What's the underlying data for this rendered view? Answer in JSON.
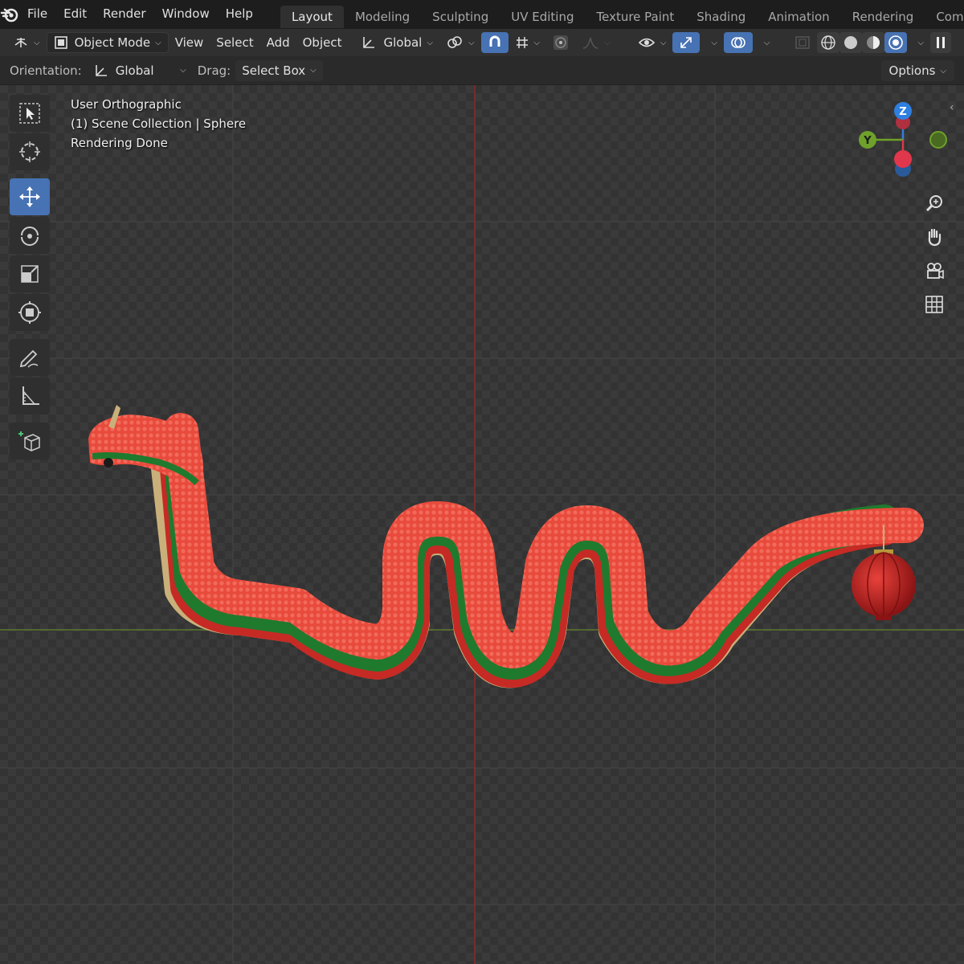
{
  "menubar": {
    "items": [
      "File",
      "Edit",
      "Render",
      "Window",
      "Help"
    ],
    "workspaces": [
      "Layout",
      "Modeling",
      "Sculpting",
      "UV Editing",
      "Texture Paint",
      "Shading",
      "Animation",
      "Rendering",
      "Com"
    ],
    "active_workspace": "Layout"
  },
  "header": {
    "mode": "Object Mode",
    "menus": [
      "View",
      "Select",
      "Add",
      "Object"
    ],
    "transform_orientation": "Global"
  },
  "toolsettings": {
    "orientation_label": "Orientation:",
    "orientation_value": "Global",
    "drag_label": "Drag:",
    "drag_value": "Select Box",
    "options": "Options"
  },
  "viewport": {
    "view_name": "User Orthographic",
    "collection": "(1) Scene Collection | Sphere",
    "status": "Rendering Done"
  },
  "gizmo": {
    "z_label": "Z",
    "y_label": "Y",
    "z_color": "#2f7fe0",
    "y_color": "#6ea12a",
    "x_color": "#e0374c"
  },
  "colors": {
    "accent": "#4772b3",
    "snake_red": "#e8463a",
    "snake_green": "#1f7a2e",
    "x_axis_line": "#8a2b2b",
    "y_axis_line": "#5a7a2a"
  }
}
